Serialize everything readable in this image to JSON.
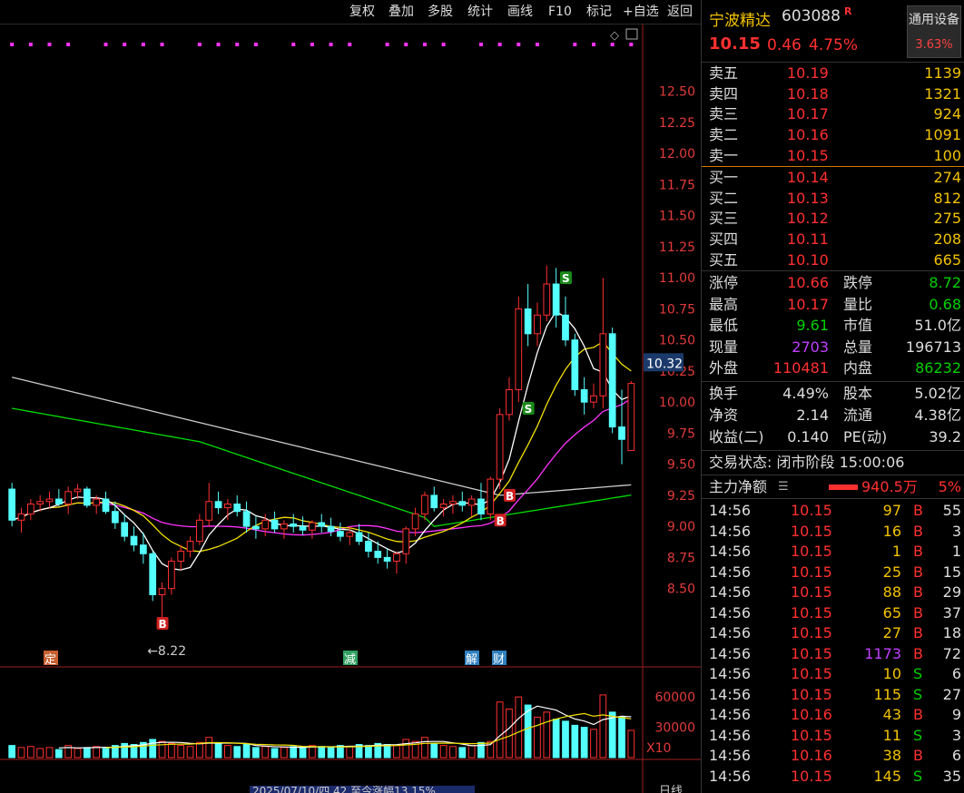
{
  "toolbar": {
    "buttons": [
      "复权",
      "叠加",
      "多股",
      "统计",
      "画线",
      "F10",
      "标记",
      "+自选",
      "返回"
    ]
  },
  "chart": {
    "price_axis": [
      "12.50",
      "12.25",
      "12.00",
      "11.75",
      "11.50",
      "11.25",
      "11.00",
      "10.75",
      "10.50",
      "10.25",
      "10.00",
      "9.75",
      "9.50",
      "9.25",
      "9.00",
      "8.75",
      "8.50"
    ],
    "current_price_tag": "10.32",
    "low_annotation": "←8.22",
    "volume_axis": [
      "60000",
      "30000"
    ],
    "volume_unit": "X10",
    "event_markers": [
      "定",
      "减",
      "解",
      "财"
    ],
    "signal_b": "B",
    "signal_s": "S",
    "bottom_bar_text": "2025/07/10/四 42 至今涨幅13.15%",
    "bottom_right_label": "日线",
    "colors": {
      "up": "#ff3030",
      "down": "#54ffff",
      "ma5": "#ffffff",
      "ma10": "#f2e000",
      "ma20": "#ff33ff",
      "ma60": "#00dd00",
      "ma120": "#cccccc",
      "bg": "#000000"
    }
  },
  "chart_data": {
    "type": "candlestick",
    "ylim": [
      8.22,
      12.6
    ],
    "ohlc": [
      [
        9.3,
        9.35,
        9.0,
        9.05
      ],
      [
        9.05,
        9.15,
        8.95,
        9.1
      ],
      [
        9.1,
        9.22,
        9.05,
        9.18
      ],
      [
        9.18,
        9.25,
        9.12,
        9.2
      ],
      [
        9.2,
        9.28,
        9.15,
        9.22
      ],
      [
        9.22,
        9.3,
        9.16,
        9.18
      ],
      [
        9.18,
        9.32,
        9.1,
        9.28
      ],
      [
        9.28,
        9.34,
        9.22,
        9.3
      ],
      [
        9.3,
        9.32,
        9.15,
        9.17
      ],
      [
        9.17,
        9.25,
        9.1,
        9.22
      ],
      [
        9.22,
        9.28,
        9.1,
        9.12
      ],
      [
        9.12,
        9.2,
        8.98,
        9.03
      ],
      [
        9.03,
        9.1,
        8.88,
        8.92
      ],
      [
        8.92,
        9.0,
        8.8,
        8.85
      ],
      [
        8.85,
        8.95,
        8.7,
        8.78
      ],
      [
        8.78,
        8.8,
        8.4,
        8.45
      ],
      [
        8.45,
        8.55,
        8.22,
        8.5
      ],
      [
        8.5,
        8.75,
        8.45,
        8.72
      ],
      [
        8.72,
        8.85,
        8.65,
        8.8
      ],
      [
        8.8,
        8.92,
        8.75,
        8.88
      ],
      [
        8.88,
        9.1,
        8.85,
        9.05
      ],
      [
        9.05,
        9.35,
        9.0,
        9.2
      ],
      [
        9.2,
        9.28,
        9.1,
        9.15
      ],
      [
        9.15,
        9.22,
        9.05,
        9.18
      ],
      [
        9.18,
        9.25,
        9.08,
        9.12
      ],
      [
        9.12,
        9.2,
        8.95,
        9.0
      ],
      [
        9.0,
        9.08,
        8.9,
        8.98
      ],
      [
        8.98,
        9.1,
        8.92,
        9.05
      ],
      [
        9.05,
        9.12,
        8.95,
        8.98
      ],
      [
        8.98,
        9.05,
        8.9,
        9.02
      ],
      [
        9.02,
        9.1,
        8.95,
        9.0
      ],
      [
        9.0,
        9.08,
        8.93,
        8.97
      ],
      [
        8.97,
        9.05,
        8.9,
        9.03
      ],
      [
        9.03,
        9.1,
        8.95,
        9.0
      ],
      [
        9.0,
        9.07,
        8.92,
        8.96
      ],
      [
        8.96,
        9.03,
        8.88,
        8.92
      ],
      [
        8.92,
        9.0,
        8.85,
        8.95
      ],
      [
        8.95,
        9.02,
        8.85,
        8.88
      ],
      [
        8.88,
        8.95,
        8.75,
        8.8
      ],
      [
        8.8,
        8.88,
        8.7,
        8.75
      ],
      [
        8.75,
        8.82,
        8.66,
        8.72
      ],
      [
        8.72,
        8.8,
        8.62,
        8.78
      ],
      [
        8.78,
        9.0,
        8.7,
        8.98
      ],
      [
        8.98,
        9.15,
        8.92,
        9.1
      ],
      [
        9.1,
        9.28,
        9.05,
        9.25
      ],
      [
        9.25,
        9.32,
        9.12,
        9.15
      ],
      [
        9.15,
        9.22,
        9.08,
        9.18
      ],
      [
        9.18,
        9.25,
        9.1,
        9.2
      ],
      [
        9.2,
        9.28,
        9.12,
        9.17
      ],
      [
        9.17,
        9.25,
        9.08,
        9.22
      ],
      [
        9.22,
        9.35,
        9.05,
        9.1
      ],
      [
        9.1,
        9.4,
        9.05,
        9.38
      ],
      [
        9.38,
        9.95,
        9.3,
        9.9
      ],
      [
        9.9,
        10.2,
        9.85,
        10.1
      ],
      [
        10.1,
        10.85,
        10.0,
        10.75
      ],
      [
        10.75,
        10.95,
        10.45,
        10.55
      ],
      [
        10.55,
        10.8,
        10.45,
        10.7
      ],
      [
        10.7,
        11.1,
        10.65,
        10.95
      ],
      [
        10.95,
        11.08,
        10.6,
        10.7
      ],
      [
        10.7,
        10.85,
        10.45,
        10.5
      ],
      [
        10.5,
        10.55,
        10.05,
        10.1
      ],
      [
        10.1,
        10.2,
        9.9,
        10.0
      ],
      [
        10.0,
        10.15,
        9.95,
        10.05
      ],
      [
        10.05,
        11.0,
        9.95,
        10.55
      ],
      [
        10.55,
        10.6,
        9.75,
        9.8
      ],
      [
        9.8,
        10.1,
        9.5,
        9.7
      ],
      [
        9.61,
        10.17,
        9.61,
        10.15
      ]
    ],
    "volume": [
      12,
      10,
      11,
      9,
      10,
      8,
      12,
      9,
      10,
      11,
      9,
      12,
      14,
      13,
      15,
      18,
      16,
      14,
      12,
      11,
      15,
      20,
      14,
      12,
      11,
      13,
      10,
      11,
      9,
      10,
      11,
      10,
      12,
      11,
      10,
      12,
      11,
      13,
      12,
      14,
      13,
      12,
      18,
      16,
      20,
      14,
      12,
      11,
      10,
      12,
      15,
      16,
      55,
      48,
      60,
      52,
      40,
      45,
      38,
      36,
      32,
      30,
      28,
      62,
      45,
      40,
      27
    ]
  },
  "quote": {
    "name": "宁波精达",
    "code": "603088",
    "r_badge": "R",
    "settings_label": "通用设备",
    "settings_pct": "3.63%",
    "price": "10.15",
    "change": "0.46",
    "change_pct": "4.75%",
    "asks": [
      {
        "label": "卖五",
        "price": "10.19",
        "vol": "1139"
      },
      {
        "label": "卖四",
        "price": "10.18",
        "vol": "1321"
      },
      {
        "label": "卖三",
        "price": "10.17",
        "vol": "924"
      },
      {
        "label": "卖二",
        "price": "10.16",
        "vol": "1091"
      },
      {
        "label": "卖一",
        "price": "10.15",
        "vol": "100"
      }
    ],
    "bids": [
      {
        "label": "买一",
        "price": "10.14",
        "vol": "274"
      },
      {
        "label": "买二",
        "price": "10.13",
        "vol": "812"
      },
      {
        "label": "买三",
        "price": "10.12",
        "vol": "275"
      },
      {
        "label": "买四",
        "price": "10.11",
        "vol": "208"
      },
      {
        "label": "买五",
        "price": "10.10",
        "vol": "665"
      }
    ],
    "stats1": [
      {
        "l1": "涨停",
        "v1": "10.66",
        "c1": "red",
        "l2": "跌停",
        "v2": "8.72",
        "c2": "green"
      },
      {
        "l1": "最高",
        "v1": "10.17",
        "c1": "red",
        "l2": "量比",
        "v2": "0.68",
        "c2": "green"
      },
      {
        "l1": "最低",
        "v1": "9.61",
        "c1": "green",
        "l2": "市值",
        "v2": "51.0亿",
        "c2": "white"
      },
      {
        "l1": "现量",
        "v1": "2703",
        "c1": "purple",
        "l2": "总量",
        "v2": "196713",
        "c2": "white"
      },
      {
        "l1": "外盘",
        "v1": "110481",
        "c1": "red",
        "l2": "内盘",
        "v2": "86232",
        "c2": "green"
      }
    ],
    "stats2": [
      {
        "l1": "换手",
        "v1": "4.49%",
        "l2": "股本",
        "v2": "5.02亿"
      },
      {
        "l1": "净资",
        "v1": "2.14",
        "l2": "流通",
        "v2": "4.38亿"
      },
      {
        "l1": "收益(二)",
        "v1": "0.140",
        "l2": "PE(动)",
        "v2": "39.2"
      }
    ],
    "trade_status": "交易状态: 闭市阶段 15:00:06",
    "main_flow_label": "主力净额",
    "main_flow_value": "940.5万",
    "main_flow_pct": "5%",
    "ticks": [
      {
        "t": "14:56",
        "p": "10.15",
        "v": "97",
        "d": "B",
        "n": "55"
      },
      {
        "t": "14:56",
        "p": "10.15",
        "v": "16",
        "d": "B",
        "n": "3"
      },
      {
        "t": "14:56",
        "p": "10.15",
        "v": "1",
        "d": "B",
        "n": "1"
      },
      {
        "t": "14:56",
        "p": "10.15",
        "v": "25",
        "d": "B",
        "n": "15"
      },
      {
        "t": "14:56",
        "p": "10.15",
        "v": "88",
        "d": "B",
        "n": "29"
      },
      {
        "t": "14:56",
        "p": "10.15",
        "v": "65",
        "d": "B",
        "n": "37"
      },
      {
        "t": "14:56",
        "p": "10.15",
        "v": "27",
        "d": "B",
        "n": "18"
      },
      {
        "t": "14:56",
        "p": "10.15",
        "v": "1173",
        "d": "B",
        "n": "72"
      },
      {
        "t": "14:56",
        "p": "10.15",
        "v": "10",
        "d": "S",
        "n": "6"
      },
      {
        "t": "14:56",
        "p": "10.15",
        "v": "115",
        "d": "S",
        "n": "27"
      },
      {
        "t": "14:56",
        "p": "10.16",
        "v": "43",
        "d": "B",
        "n": "9"
      },
      {
        "t": "14:56",
        "p": "10.15",
        "v": "11",
        "d": "S",
        "n": "3"
      },
      {
        "t": "14:56",
        "p": "10.16",
        "v": "38",
        "d": "B",
        "n": "6"
      },
      {
        "t": "14:56",
        "p": "10.15",
        "v": "145",
        "d": "S",
        "n": "35"
      }
    ]
  }
}
